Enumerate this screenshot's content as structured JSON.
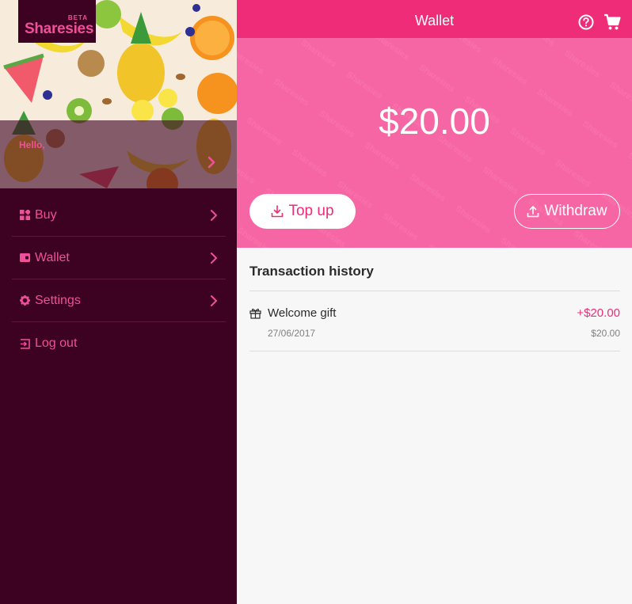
{
  "brand": {
    "name": "Sharesies",
    "tag": "BETA",
    "accent": "#ee2c78",
    "sidebar_bg": "#3d0122"
  },
  "sidebar": {
    "greeting": "Hello,",
    "items": [
      {
        "label": "Buy",
        "icon": "grid-icon"
      },
      {
        "label": "Wallet",
        "icon": "wallet-icon"
      },
      {
        "label": "Settings",
        "icon": "gear-icon"
      },
      {
        "label": "Log out",
        "icon": "logout-icon"
      }
    ]
  },
  "header": {
    "title": "Wallet",
    "icons": [
      "help-icon",
      "cart-icon"
    ]
  },
  "wallet": {
    "balance": "$20.00",
    "top_up_label": "Top up",
    "withdraw_label": "Withdraw"
  },
  "history": {
    "title": "Transaction history",
    "transactions": [
      {
        "name": "Welcome gift",
        "date": "27/06/2017",
        "amount": "+$20.00",
        "balance": "$20.00",
        "icon": "gift-icon"
      }
    ]
  }
}
